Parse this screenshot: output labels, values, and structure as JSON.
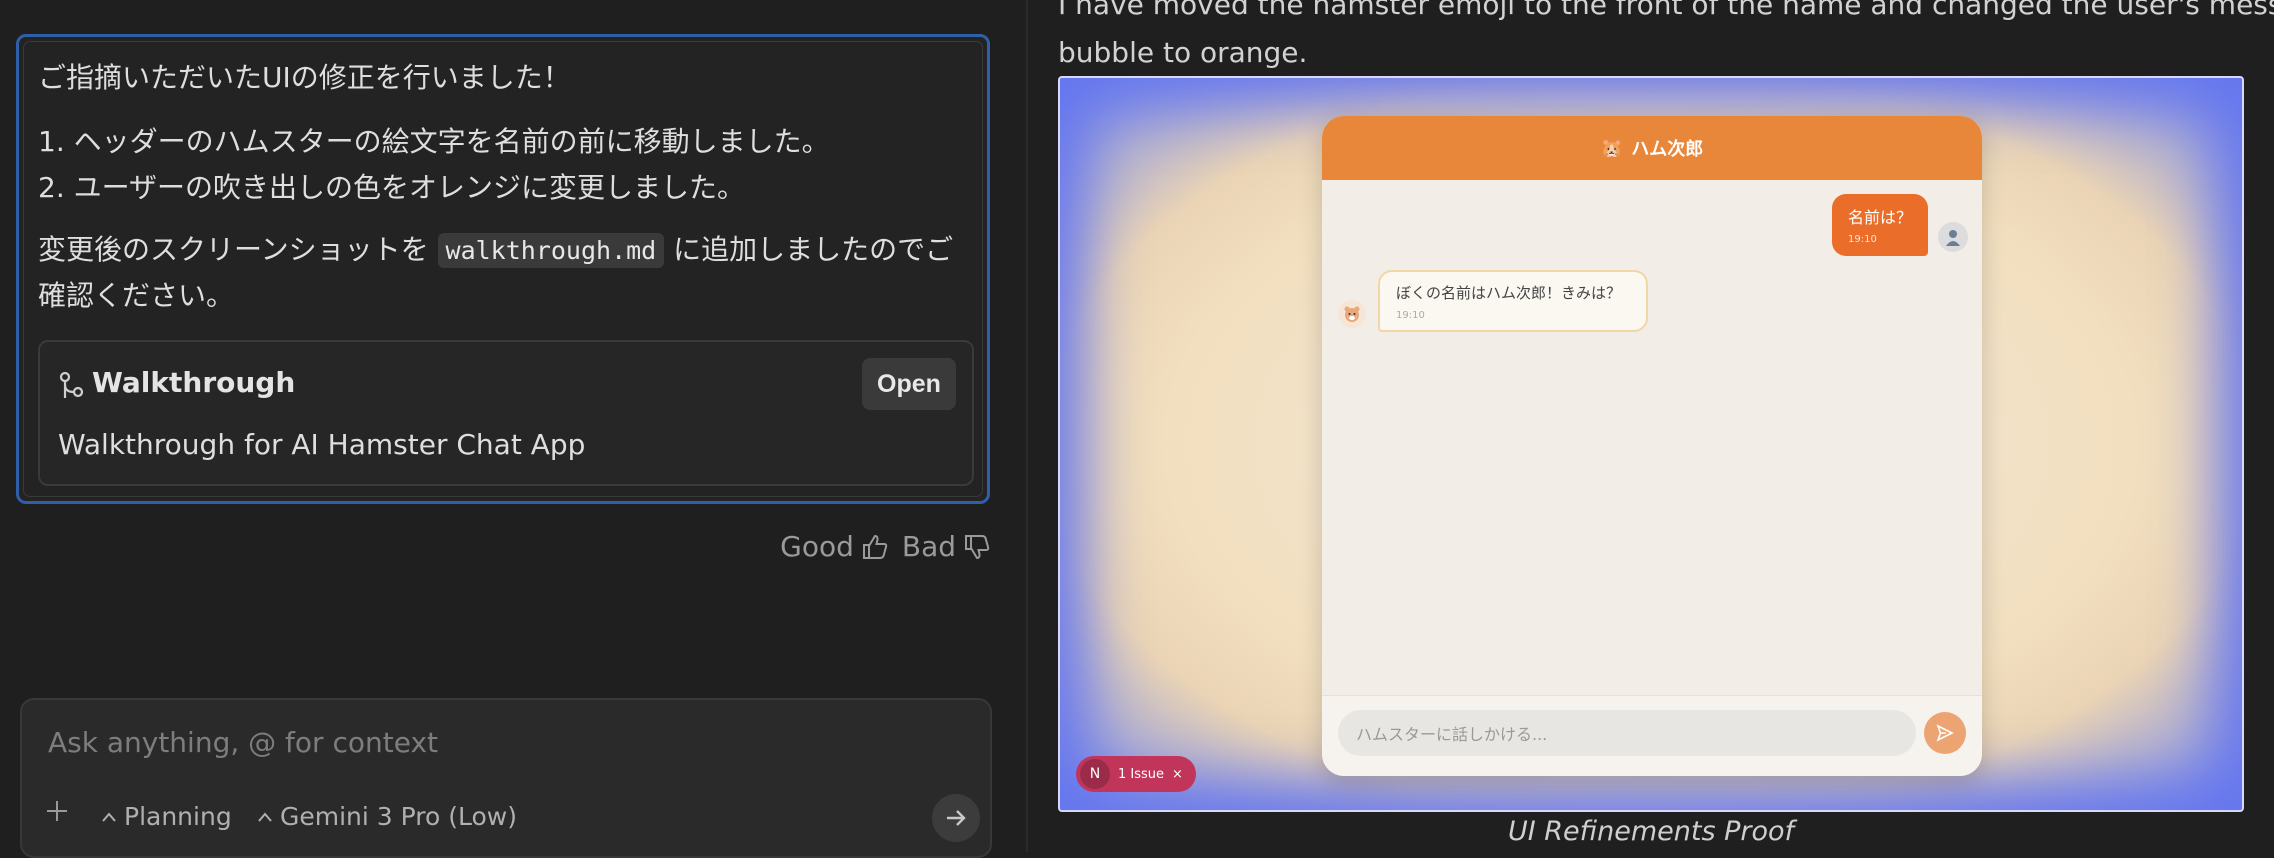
{
  "message": {
    "intro": "ご指摘いただいたUIの修正を行いました！",
    "items": [
      "1. ヘッダーのハムスターの絵文字を名前の前に移動しました。",
      "2. ユーザーの吹き出しの色をオレンジに変更しました。"
    ],
    "para_prefix": "変更後のスクリーンショットを",
    "para_code": "walkthrough.md",
    "para_suffix_line1": "に追加しましたのでご",
    "para_line2": "確認ください。"
  },
  "walkthrough": {
    "title": "Walkthrough",
    "open_label": "Open",
    "description": "Walkthrough for AI Hamster Chat App"
  },
  "feedback": {
    "good_label": "Good",
    "bad_label": "Bad"
  },
  "composer": {
    "placeholder": "Ask anything, @ for context",
    "mode_label": "Planning",
    "model_label": "Gemini 3 Pro (Low)"
  },
  "right_panel": {
    "text_line1": "I have moved the hamster emoji to the front of the name and changed the user's message",
    "text_line2": "bubble to orange.",
    "caption": "UI Refinements Proof"
  },
  "screenshot": {
    "header_emoji": "🐹",
    "header_name": "ハム次郎",
    "user_message": "名前は？",
    "user_time": "19:10",
    "bot_message": "ぼくの名前はハム次郎！きみは？",
    "bot_time": "19:10",
    "input_placeholder": "ハムスターに話しかける...",
    "issue_avatar": "N",
    "issue_label": "1 Issue",
    "issue_close": "×"
  },
  "colors": {
    "accent_border": "#2f5fa8",
    "header_orange": "#e8873a",
    "user_bubble": "#ea6e2a",
    "issue_badge": "#c2355a"
  }
}
